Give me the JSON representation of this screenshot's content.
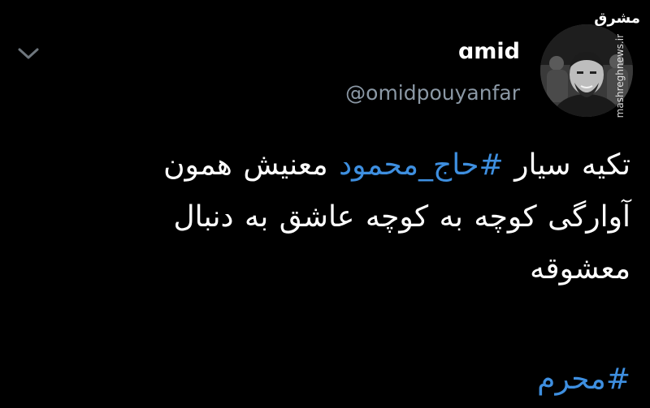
{
  "watermark": {
    "logo": "مشرق",
    "site": "mashreghnews.ir"
  },
  "author": {
    "display_name": "ɑmid",
    "handle": "@omidpouyanfar"
  },
  "icons": {
    "menu": "chevron-down-icon",
    "avatar": "profile-photo"
  },
  "tweet": {
    "line1_part1": "تکیه سیار ",
    "line1_hashtag": "#حاج_محمود",
    "line1_part2": " معنیش همون",
    "line2": "آوارگی کوچه به کوچه عاشق به دنبال",
    "line3": "معشوقه",
    "trailing_hashtag": "#محرم"
  },
  "colors": {
    "background": "#000000",
    "text": "#ffffff",
    "secondary": "#8b98a5",
    "link": "#3e8fe0"
  }
}
